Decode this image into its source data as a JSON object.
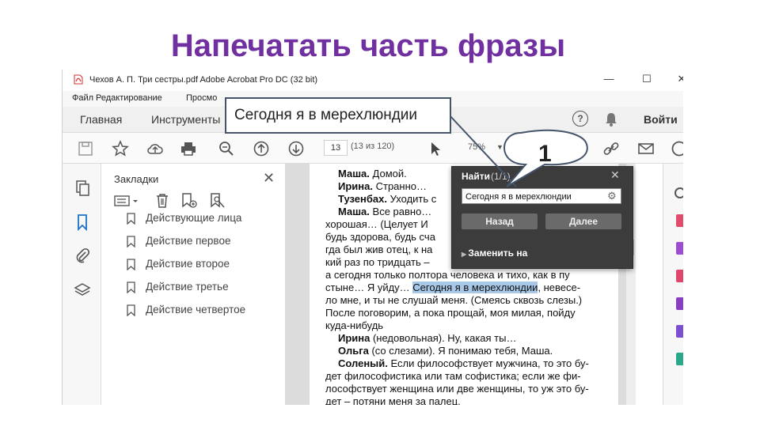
{
  "slide_title": "Напечатать часть фразы",
  "window": {
    "title": "Чехов А. П.   Три сестры.pdf   Adobe Acrobat Pro DC (32 bit)",
    "minimize": "—",
    "maximize": "☐",
    "close": "✕"
  },
  "menu": {
    "file": "Файл",
    "edit": "Редактирование",
    "view": "Просмо"
  },
  "nav": {
    "home": "Главная",
    "tools": "Инструменты",
    "help": "?",
    "sign_in": "Войти"
  },
  "toolbar": {
    "page": "13",
    "page_of": "(13 из 120)",
    "zoom": "75%"
  },
  "bookmarks": {
    "title": "Закладки",
    "close": "✕",
    "items": [
      "Действующие лица",
      "Действие первое",
      "Действие второе",
      "Действие третье",
      "Действие четвертое"
    ]
  },
  "document": {
    "lines": [
      {
        "bold": "Маша.",
        "text": " Домой."
      },
      {
        "bold": "Ирина.",
        "text": " Странно…"
      },
      {
        "bold": "Тузенбах.",
        "text": " Уходить с"
      },
      {
        "bold": "Маша.",
        "text": " Все равно…"
      },
      {
        "bold": "",
        "text": "хорошая… (Целует И"
      },
      {
        "bold": "",
        "text": "будь здорова, будь сча"
      },
      {
        "bold": "",
        "text": "гда был жив отец, к на"
      },
      {
        "bold": "",
        "text": "кий раз по тридцать –"
      },
      {
        "bold": "",
        "text": "а сегодня только полтора человека и тихо, как в пу"
      },
      {
        "bold": "",
        "text": "стыне… Я уйду…",
        "highlight": "Сегодня я в мерехлюндии",
        "after": ", невесе-"
      },
      {
        "bold": "",
        "text": "ло мне, и ты не слушай меня. (Смеясь сквозь слезы.)"
      },
      {
        "bold": "",
        "text": "После поговорим, а пока прощай, моя милая, пойду"
      },
      {
        "bold": "",
        "text": "куда-нибудь"
      },
      {
        "bold": "Ирина",
        "text": " (недовольная). Ну, какая ты…"
      },
      {
        "bold": "Ольга",
        "text": " (со слезами). Я понимаю тебя, Маша."
      },
      {
        "bold": "Соленый.",
        "text": " Если философствует мужчина, то это бу-"
      },
      {
        "bold": "",
        "text": "дет философистика или там софистика; если же фи-"
      },
      {
        "bold": "",
        "text": "лософствует женщина или две женщины, то уж это бу-"
      },
      {
        "bold": "",
        "text": "дет – потяни меня за палец."
      }
    ]
  },
  "find": {
    "title": "Найти",
    "count": "(1/1)",
    "close": "✕",
    "query": "Сегодня я в мерехлюндии",
    "back": "Назад",
    "next": "Далее",
    "replace": "Заменить на"
  },
  "callout": {
    "text": "Сегодня я в мерехлюндии",
    "bubble": "1"
  },
  "colors": {
    "title": "#7030a0",
    "highlight": "#a8c8e8",
    "find_bg": "#3c3c3c"
  }
}
